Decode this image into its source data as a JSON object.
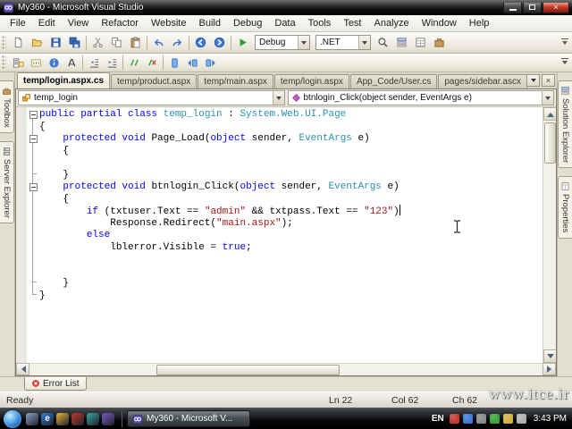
{
  "window": {
    "title": "My360 - Microsoft Visual Studio"
  },
  "menu_bar": {
    "items": [
      "File",
      "Edit",
      "View",
      "Refactor",
      "Website",
      "Build",
      "Debug",
      "Data",
      "Tools",
      "Test",
      "Analyze",
      "Window",
      "Help"
    ]
  },
  "toolbar_standard": {
    "left_icons": [
      "new-file",
      "open-folder",
      "save",
      "save-all",
      "|",
      "cut",
      "copy",
      "paste",
      "|",
      "undo",
      "redo",
      "|",
      "navigate-back",
      "navigate-forward",
      "|",
      "start-debug"
    ],
    "combos": [
      {
        "name": "solution-configurations-combo",
        "value": "Debug"
      },
      {
        "name": "solution-platforms-combo",
        "value": ".NET"
      }
    ],
    "right_icons": [
      "find-in-files",
      "solution-explorer",
      "properties-window",
      "toolbox-panel"
    ]
  },
  "toolbar_text_editor": {
    "icons": [
      "display-member-list",
      "display-parameter-info",
      "display-quick-info",
      "display-word-completion",
      "|",
      "decrease-indent",
      "increase-indent",
      "|",
      "comment-lines",
      "uncomment-lines",
      "|",
      "toggle-bookmark",
      "previous-bookmark",
      "next-bookmark"
    ]
  },
  "document_tabs": [
    {
      "label": "temp/login.aspx.cs",
      "active": true
    },
    {
      "label": "temp/product.aspx",
      "active": false
    },
    {
      "label": "temp/main.aspx",
      "active": false
    },
    {
      "label": "temp/login.aspx",
      "active": false
    },
    {
      "label": "App_Code/User.cs",
      "active": false
    },
    {
      "label": "pages/sidebar.ascx",
      "active": false
    }
  ],
  "left_panel_tabs": [
    {
      "label": "Toolbox",
      "icon": "toolbox-icon"
    },
    {
      "label": "Server Explorer",
      "icon": "server-explorer-icon"
    }
  ],
  "right_panel_tabs": [
    {
      "label": "Solution Explorer",
      "icon": "solution-explorer-icon"
    },
    {
      "label": "Properties",
      "icon": "properties-icon"
    }
  ],
  "editor": {
    "types_combo": "temp_login",
    "members_combo": "btnlogin_Click(object sender, EventArgs e)",
    "syntax_colors": {
      "keyword": "#0000ff",
      "type": "#2b91af",
      "string": "#a31515",
      "plain": "#000000",
      "background": "#ffffff"
    },
    "code_lines": [
      {
        "fold": true,
        "fold_end": 15,
        "segs": [
          [
            "public partial class ",
            "kw"
          ],
          [
            "temp_login",
            "ty"
          ],
          [
            " : ",
            "pl"
          ],
          [
            "System.Web.UI.Page",
            "ty"
          ]
        ]
      },
      {
        "fold": false,
        "segs": [
          [
            "{",
            "pl"
          ]
        ]
      },
      {
        "fold": true,
        "fold_end": 5,
        "segs": [
          [
            "    ",
            "pl"
          ],
          [
            "protected void ",
            "kw"
          ],
          [
            "Page_Load(",
            "pl"
          ],
          [
            "object",
            "kw"
          ],
          [
            " sender, ",
            "pl"
          ],
          [
            "EventArgs",
            "ty"
          ],
          [
            " e)",
            "pl"
          ]
        ]
      },
      {
        "fold": false,
        "segs": [
          [
            "    {",
            "pl"
          ]
        ]
      },
      {
        "fold": false,
        "segs": []
      },
      {
        "fold": false,
        "segs": [
          [
            "    }",
            "pl"
          ]
        ]
      },
      {
        "fold": true,
        "fold_end": 14,
        "segs": [
          [
            "    ",
            "pl"
          ],
          [
            "protected void ",
            "kw"
          ],
          [
            "btnlogin_Click(",
            "pl"
          ],
          [
            "object",
            "kw"
          ],
          [
            " sender, ",
            "pl"
          ],
          [
            "EventArgs",
            "ty"
          ],
          [
            " e)",
            "pl"
          ]
        ]
      },
      {
        "fold": false,
        "segs": [
          [
            "    {",
            "pl"
          ]
        ]
      },
      {
        "fold": false,
        "caret": true,
        "segs": [
          [
            "        ",
            "pl"
          ],
          [
            "if",
            "kw"
          ],
          [
            " (txtuser.Text == ",
            "pl"
          ],
          [
            "\"admin\"",
            "st"
          ],
          [
            " && txtpass.Text == ",
            "pl"
          ],
          [
            "\"123\"",
            "st"
          ],
          [
            ")",
            "pl"
          ]
        ]
      },
      {
        "fold": false,
        "segs": [
          [
            "            Response.Redirect(",
            "pl"
          ],
          [
            "\"main.aspx\"",
            "st"
          ],
          [
            ");",
            "pl"
          ]
        ]
      },
      {
        "fold": false,
        "segs": [
          [
            "        ",
            "pl"
          ],
          [
            "else",
            "kw"
          ]
        ]
      },
      {
        "fold": false,
        "segs": [
          [
            "            lblerror.Visible = ",
            "pl"
          ],
          [
            "true",
            "kw"
          ],
          [
            ";",
            "pl"
          ]
        ]
      },
      {
        "fold": false,
        "segs": []
      },
      {
        "fold": false,
        "segs": []
      },
      {
        "fold": false,
        "segs": [
          [
            "    }",
            "pl"
          ]
        ]
      },
      {
        "fold": false,
        "segs": [
          [
            "}",
            "pl"
          ]
        ]
      }
    ]
  },
  "error_list": {
    "label": "Error List"
  },
  "status_bar": {
    "status": "Ready",
    "line": "Ln 22",
    "column": "Col 62",
    "character": "Ch 62"
  },
  "watermark": "www.itce.ir",
  "taskbar": {
    "task_button": {
      "label": "My360 - Microsoft V...",
      "icon": "visual-studio-icon"
    },
    "language_indicator": "EN",
    "clock": "3:43 PM",
    "quick_launch": [
      {
        "name": "quick-launch-icon-1",
        "color": "#8ba4c4",
        "glyph": ""
      },
      {
        "name": "quick-launch-icon-2",
        "color": "#2f7fd4",
        "glyph": "e"
      },
      {
        "name": "quick-launch-icon-3",
        "color": "#e8b33a",
        "glyph": ""
      },
      {
        "name": "quick-launch-icon-4",
        "color": "#c23b2e",
        "glyph": ""
      },
      {
        "name": "quick-launch-icon-5",
        "color": "#3aa3a3",
        "glyph": ""
      },
      {
        "name": "quick-launch-icon-6",
        "color": "#7c58c4",
        "glyph": ""
      }
    ],
    "tray_icons": [
      {
        "name": "tray-icon-1",
        "color": "#c23b2e"
      },
      {
        "name": "tray-icon-2",
        "color": "#3f78d4"
      },
      {
        "name": "tray-icon-3",
        "color": "#8a8a8a"
      },
      {
        "name": "tray-icon-4",
        "color": "#3aa33a"
      },
      {
        "name": "tray-icon-5",
        "color": "#d4b23f"
      },
      {
        "name": "tray-icon-6",
        "color": "#b0b0b0"
      }
    ]
  }
}
